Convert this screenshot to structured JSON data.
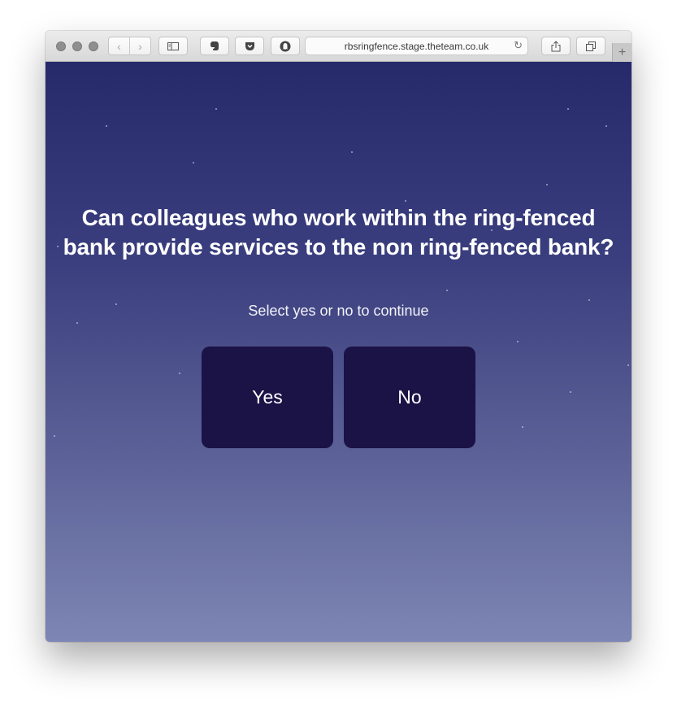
{
  "browser": {
    "url": "rbsringfence.stage.theteam.co.uk",
    "new_tab_symbol": "+",
    "icons": [
      "back-icon",
      "forward-icon",
      "sidebar-icon",
      "evernote-icon",
      "pocket-icon",
      "ghostery-icon",
      "reload-icon",
      "share-icon",
      "tabs-icon"
    ]
  },
  "page": {
    "question": "Can colleagues who work within the ring-fenced bank provide services to the non ring-fenced bank?",
    "instruction": "Select yes or no to continue",
    "buttons": {
      "yes": "Yes",
      "no": "No"
    },
    "colors": {
      "background_top": "#262a6b",
      "background_bottom": "#7d86b4",
      "button": "#1b1246",
      "text": "#ffffff"
    }
  }
}
